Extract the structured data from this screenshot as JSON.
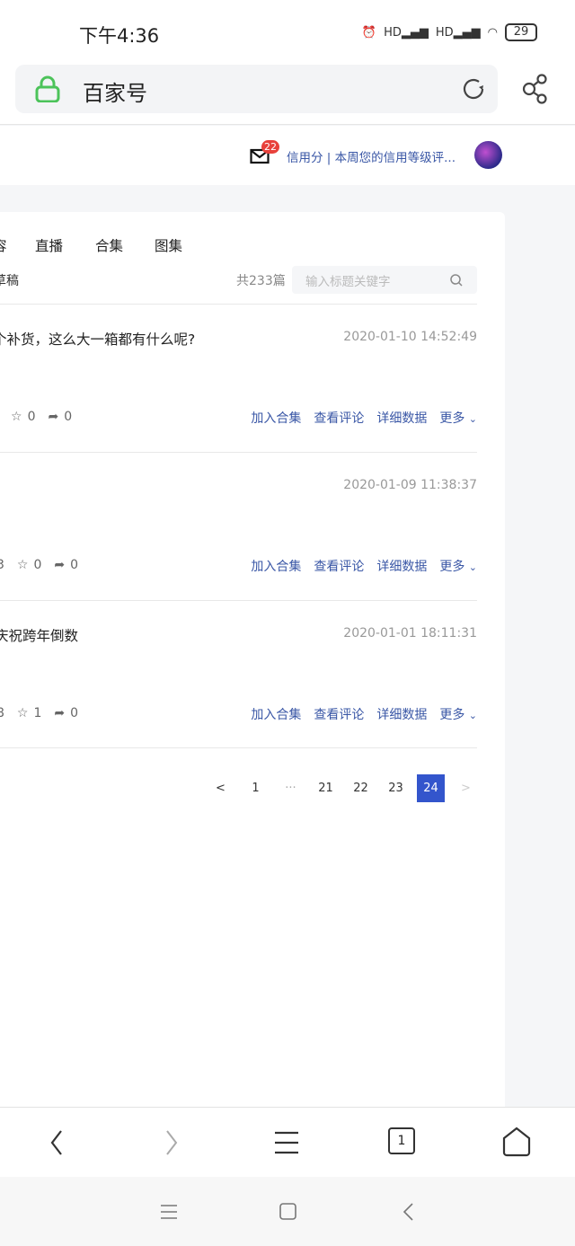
{
  "status_bar": {
    "time": "下午4:36",
    "battery": "29",
    "icons": [
      "alarm-icon",
      "signal-hd-icon",
      "signal-hd-icon",
      "wifi-icon",
      "battery-icon"
    ]
  },
  "browser": {
    "url_title": "百家号"
  },
  "header": {
    "mail_badge": "22",
    "notice": "信用分 | 本周您的信用等级评..."
  },
  "tabs": [
    "容",
    "直播",
    "合集",
    "图集"
  ],
  "filter": {
    "sub_tab": "草稿",
    "count": "共233篇",
    "search_placeholder": "输入标题关键字"
  },
  "articles": [
    {
      "title": "个补货，这么大一箱都有什么呢?",
      "date": "2020-01-10 14:52:49",
      "views": "",
      "stars": "0",
      "shares": "0"
    },
    {
      "title": "",
      "date": "2020-01-09 11:38:37",
      "views": "3",
      "stars": "0",
      "shares": "0"
    },
    {
      "title": "庆祝跨年倒数",
      "date": "2020-01-01 18:11:31",
      "views": "8",
      "stars": "1",
      "shares": "0"
    }
  ],
  "actions": {
    "add_collection": "加入合集",
    "view_comments": "查看评论",
    "details": "详细数据",
    "more": "更多"
  },
  "pagination": {
    "prev": "<",
    "pages": [
      "1",
      "···",
      "21",
      "22",
      "23",
      "24"
    ],
    "current": "24",
    "next": ">"
  },
  "bottom_nav": {
    "tab_count": "1"
  },
  "colors": {
    "link": "#3a57a6",
    "active_page": "#3355cc",
    "badge": "#e8413b",
    "lock": "#4cc35a"
  }
}
